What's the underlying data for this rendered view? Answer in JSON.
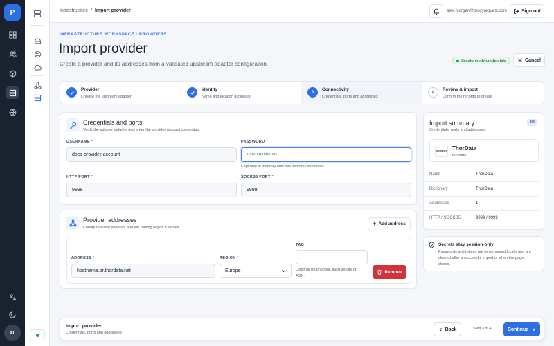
{
  "app": {
    "logo_letter": "P",
    "user_initials": "AL"
  },
  "breadcrumb": {
    "parent": "Infrastructure",
    "separator": "/",
    "current": "Import provider"
  },
  "header": {
    "email": "alex.morgan@proxyrequest.com",
    "sign_out": "Sign out"
  },
  "page": {
    "eyebrow": "INFRASTRUCTURE WORKSPACE · PROVIDERS",
    "title": "Import provider",
    "subtitle": "Create a provider and its addresses from a validated upstream adapter configuration.",
    "badge": "Session-only credentials",
    "cancel": "Cancel"
  },
  "steps": [
    {
      "num": "1",
      "title": "Provider",
      "desc": "Choose the upstream adapter",
      "state": "done"
    },
    {
      "num": "2",
      "title": "Identity",
      "desc": "Name and location dictionary",
      "state": "done"
    },
    {
      "num": "3",
      "title": "Connectivity",
      "desc": "Credentials, ports and addresses",
      "state": "current"
    },
    {
      "num": "4",
      "title": "Review & import",
      "desc": "Confirm the records to create",
      "state": "todo"
    }
  ],
  "credentials": {
    "title": "Credentials and ports",
    "desc": "Verify the adapter defaults and enter the provider account credentials.",
    "username_label": "USERNAME",
    "username_value": "docs-provider-account",
    "password_label": "PASSWORD",
    "password_value": "••••••••••••••••••",
    "password_hint": "Kept only in memory until this import is submitted.",
    "http_label": "HTTP PORT",
    "http_value": "9999",
    "socks_label": "SOCKS5 PORT",
    "socks_value": "9999",
    "required_mark": "*"
  },
  "addresses": {
    "title": "Provider addresses",
    "desc": "Configure every endpoint and the routing region it serves.",
    "add_label": "Add address",
    "address_label": "ADDRESS",
    "address_value": "hostname.pr.thordata.net",
    "region_label": "REGION",
    "region_value": "Europe",
    "tag_label": "TAG",
    "tag_value": "",
    "tag_hint_1": "Optional routing role, such as city or",
    "tag_hint_2": "ASN.",
    "remove_label": "Remove"
  },
  "summary": {
    "title": "Import summary",
    "desc": "Credentials, ports and addresses",
    "count": "3/4",
    "provider_name": "ThorData",
    "provider_slug": "thordata",
    "logo_text": "THORDATA",
    "rows": [
      {
        "key": "Name",
        "value": "ThorData"
      },
      {
        "key": "Dictionary",
        "value": "ThorData"
      },
      {
        "key": "Addresses",
        "value": "1"
      },
      {
        "key": "HTTP / SOCKS5",
        "value": "9999 / 9999"
      }
    ]
  },
  "notice": {
    "title": "Secrets stay session-only",
    "body_1": "Passwords and tokens are never stored locally and are",
    "body_2": "cleared after a successful import or when the page",
    "body_3": "closes."
  },
  "footer": {
    "title": "Import provider",
    "desc": "Credentials, ports and addresses",
    "back": "Back",
    "step_count": "Step 3 of 4",
    "continue": "Continue"
  },
  "colors": {
    "accent": "#2f6fe4",
    "rail": "#1a2230",
    "danger": "#d0333c",
    "success": "#1e9e5a"
  }
}
